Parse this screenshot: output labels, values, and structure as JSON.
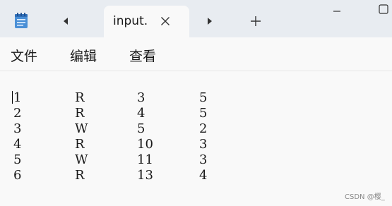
{
  "tab": {
    "title": "input.",
    "close_icon": "close-icon"
  },
  "icons": {
    "app": "notepad-icon",
    "back": "caret-left-icon",
    "forward": "caret-right-icon",
    "new_tab": "plus-icon",
    "minimize": "minimize-icon",
    "maximize": "maximize-icon"
  },
  "menu": {
    "file": "文件",
    "edit": "编辑",
    "view": "查看"
  },
  "editor": {
    "rows": [
      [
        "1",
        "R",
        "3",
        "5"
      ],
      [
        "2",
        "R",
        "4",
        "5"
      ],
      [
        "3",
        "W",
        "5",
        "2"
      ],
      [
        "4",
        "R",
        "10",
        "3"
      ],
      [
        "5",
        "W",
        "11",
        "3"
      ],
      [
        "6",
        "R",
        "13",
        "4"
      ]
    ]
  },
  "watermark": "CSDN @樱_"
}
